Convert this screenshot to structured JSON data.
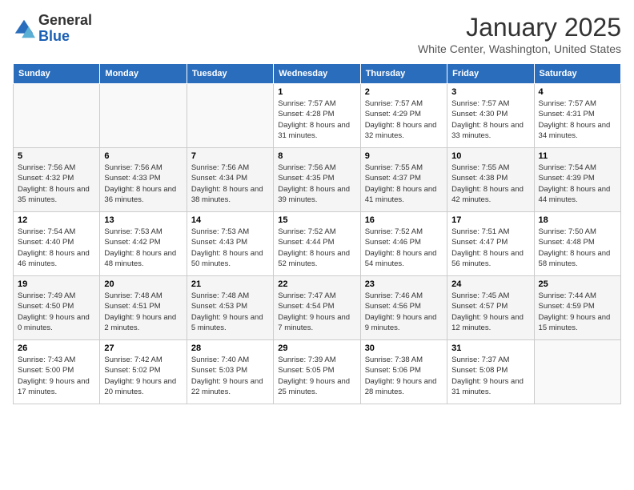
{
  "header": {
    "logo_general": "General",
    "logo_blue": "Blue",
    "month_title": "January 2025",
    "location": "White Center, Washington, United States"
  },
  "weekdays": [
    "Sunday",
    "Monday",
    "Tuesday",
    "Wednesday",
    "Thursday",
    "Friday",
    "Saturday"
  ],
  "weeks": [
    [
      {
        "day": "",
        "info": ""
      },
      {
        "day": "",
        "info": ""
      },
      {
        "day": "",
        "info": ""
      },
      {
        "day": "1",
        "info": "Sunrise: 7:57 AM\nSunset: 4:28 PM\nDaylight: 8 hours and 31 minutes."
      },
      {
        "day": "2",
        "info": "Sunrise: 7:57 AM\nSunset: 4:29 PM\nDaylight: 8 hours and 32 minutes."
      },
      {
        "day": "3",
        "info": "Sunrise: 7:57 AM\nSunset: 4:30 PM\nDaylight: 8 hours and 33 minutes."
      },
      {
        "day": "4",
        "info": "Sunrise: 7:57 AM\nSunset: 4:31 PM\nDaylight: 8 hours and 34 minutes."
      }
    ],
    [
      {
        "day": "5",
        "info": "Sunrise: 7:56 AM\nSunset: 4:32 PM\nDaylight: 8 hours and 35 minutes."
      },
      {
        "day": "6",
        "info": "Sunrise: 7:56 AM\nSunset: 4:33 PM\nDaylight: 8 hours and 36 minutes."
      },
      {
        "day": "7",
        "info": "Sunrise: 7:56 AM\nSunset: 4:34 PM\nDaylight: 8 hours and 38 minutes."
      },
      {
        "day": "8",
        "info": "Sunrise: 7:56 AM\nSunset: 4:35 PM\nDaylight: 8 hours and 39 minutes."
      },
      {
        "day": "9",
        "info": "Sunrise: 7:55 AM\nSunset: 4:37 PM\nDaylight: 8 hours and 41 minutes."
      },
      {
        "day": "10",
        "info": "Sunrise: 7:55 AM\nSunset: 4:38 PM\nDaylight: 8 hours and 42 minutes."
      },
      {
        "day": "11",
        "info": "Sunrise: 7:54 AM\nSunset: 4:39 PM\nDaylight: 8 hours and 44 minutes."
      }
    ],
    [
      {
        "day": "12",
        "info": "Sunrise: 7:54 AM\nSunset: 4:40 PM\nDaylight: 8 hours and 46 minutes."
      },
      {
        "day": "13",
        "info": "Sunrise: 7:53 AM\nSunset: 4:42 PM\nDaylight: 8 hours and 48 minutes."
      },
      {
        "day": "14",
        "info": "Sunrise: 7:53 AM\nSunset: 4:43 PM\nDaylight: 8 hours and 50 minutes."
      },
      {
        "day": "15",
        "info": "Sunrise: 7:52 AM\nSunset: 4:44 PM\nDaylight: 8 hours and 52 minutes."
      },
      {
        "day": "16",
        "info": "Sunrise: 7:52 AM\nSunset: 4:46 PM\nDaylight: 8 hours and 54 minutes."
      },
      {
        "day": "17",
        "info": "Sunrise: 7:51 AM\nSunset: 4:47 PM\nDaylight: 8 hours and 56 minutes."
      },
      {
        "day": "18",
        "info": "Sunrise: 7:50 AM\nSunset: 4:48 PM\nDaylight: 8 hours and 58 minutes."
      }
    ],
    [
      {
        "day": "19",
        "info": "Sunrise: 7:49 AM\nSunset: 4:50 PM\nDaylight: 9 hours and 0 minutes."
      },
      {
        "day": "20",
        "info": "Sunrise: 7:48 AM\nSunset: 4:51 PM\nDaylight: 9 hours and 2 minutes."
      },
      {
        "day": "21",
        "info": "Sunrise: 7:48 AM\nSunset: 4:53 PM\nDaylight: 9 hours and 5 minutes."
      },
      {
        "day": "22",
        "info": "Sunrise: 7:47 AM\nSunset: 4:54 PM\nDaylight: 9 hours and 7 minutes."
      },
      {
        "day": "23",
        "info": "Sunrise: 7:46 AM\nSunset: 4:56 PM\nDaylight: 9 hours and 9 minutes."
      },
      {
        "day": "24",
        "info": "Sunrise: 7:45 AM\nSunset: 4:57 PM\nDaylight: 9 hours and 12 minutes."
      },
      {
        "day": "25",
        "info": "Sunrise: 7:44 AM\nSunset: 4:59 PM\nDaylight: 9 hours and 15 minutes."
      }
    ],
    [
      {
        "day": "26",
        "info": "Sunrise: 7:43 AM\nSunset: 5:00 PM\nDaylight: 9 hours and 17 minutes."
      },
      {
        "day": "27",
        "info": "Sunrise: 7:42 AM\nSunset: 5:02 PM\nDaylight: 9 hours and 20 minutes."
      },
      {
        "day": "28",
        "info": "Sunrise: 7:40 AM\nSunset: 5:03 PM\nDaylight: 9 hours and 22 minutes."
      },
      {
        "day": "29",
        "info": "Sunrise: 7:39 AM\nSunset: 5:05 PM\nDaylight: 9 hours and 25 minutes."
      },
      {
        "day": "30",
        "info": "Sunrise: 7:38 AM\nSunset: 5:06 PM\nDaylight: 9 hours and 28 minutes."
      },
      {
        "day": "31",
        "info": "Sunrise: 7:37 AM\nSunset: 5:08 PM\nDaylight: 9 hours and 31 minutes."
      },
      {
        "day": "",
        "info": ""
      }
    ]
  ]
}
